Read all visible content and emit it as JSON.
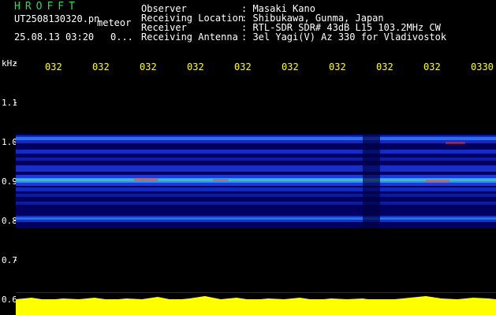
{
  "app": {
    "title": "HROFFT",
    "file": "UT2508130320.pn",
    "mode": "meteor"
  },
  "timestamp": {
    "date_time": "25.08.13 03:20",
    "value": "0..."
  },
  "info": {
    "observer_label": "Observer",
    "observer": ": Masaki Kano",
    "location_label": "Receiving Location",
    "location": ": Shibukawa, Gunma, Japan",
    "receiver_label": "Receiver",
    "receiver": ": RTL-SDR SDR# 43dB L15 103.2MHz CW",
    "antenna_label": "Receiving Antenna",
    "antenna": ": 3el Yagi(V) Az 330 for Vladivostok"
  },
  "axes": {
    "y_unit": "kHz",
    "y_ticks": [
      "1.1",
      "1.0",
      "0.9",
      "0.8",
      "0.7",
      "0.6"
    ],
    "x_ticks": [
      "032",
      "032",
      "032",
      "032",
      "032",
      "032",
      "032",
      "032",
      "032",
      "0330"
    ]
  },
  "colors": {
    "bg": "#000000",
    "text": "#ffffff",
    "accent": "#ffff00",
    "title": "#22e04a",
    "waterfall": "#000080"
  }
}
